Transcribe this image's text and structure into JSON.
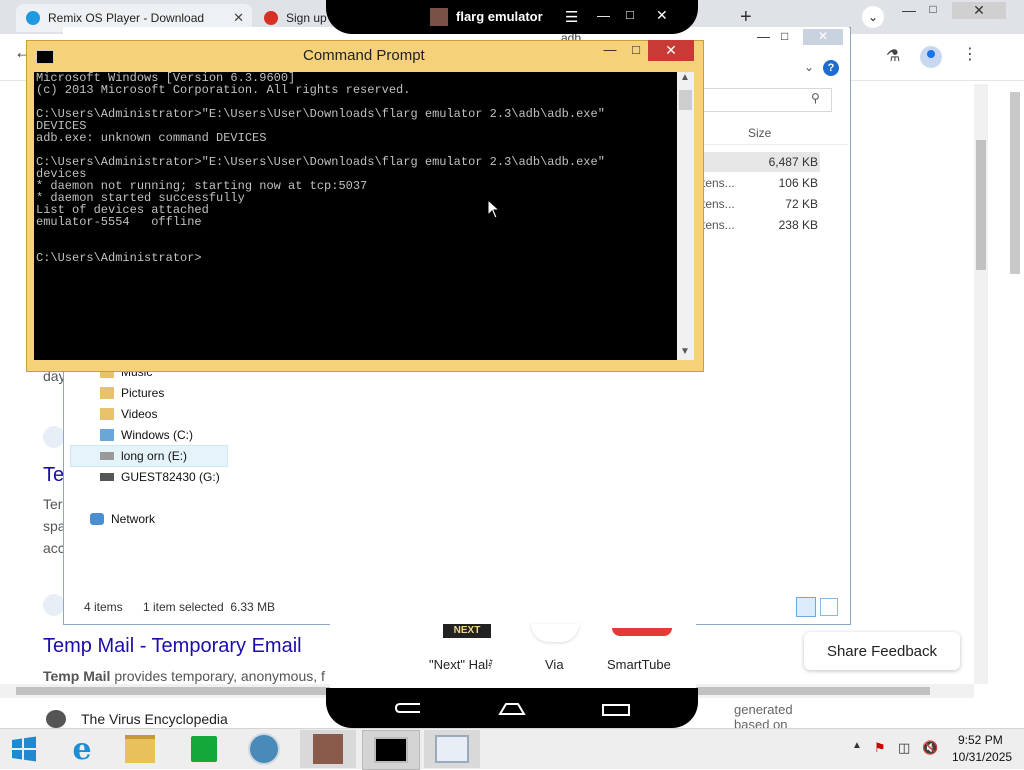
{
  "browser": {
    "tabs": [
      {
        "title": "Remix OS Player - Download",
        "favicon": "remix-icon",
        "close": "✕"
      },
      {
        "title": "Sign up",
        "favicon": "mail-icon"
      }
    ],
    "new_tab": "+",
    "results": [
      {
        "snippet": "day"
      },
      {
        "title": "Te",
        "snippet_lines": [
          "Ter",
          "spa",
          "acc"
        ]
      },
      {
        "title": "Temp Mail - Temporary Email",
        "snippet_bold": "Temp Mail",
        "snippet": "provides temporary, anonymous, f"
      },
      {
        "title": "The Virus Encyclopedia"
      }
    ],
    "right_fragment": [
      "generated",
      "based on"
    ],
    "share_feedback": "Share Feedback"
  },
  "explorer": {
    "address_fragment": "adb",
    "column_size": "Size",
    "files": [
      {
        "type": "",
        "size": "6,487 KB"
      },
      {
        "type": "tens...",
        "size": "106 KB"
      },
      {
        "type": "tens...",
        "size": "72 KB"
      },
      {
        "type": "tens...",
        "size": "238 KB"
      }
    ],
    "nav": [
      "Music",
      "Pictures",
      "Videos",
      "Windows (C:)",
      "long orn (E:)",
      "GUEST82430 (G:)",
      "Network"
    ],
    "status": {
      "items": "4 items",
      "selected": "1 item selected  6.33 MB"
    }
  },
  "emulator": {
    "title": "flarg emulator",
    "apps": [
      "\"Next\" Hal𝅀",
      "Via",
      "SmartTube"
    ],
    "next_badge": "NEXT"
  },
  "cmd": {
    "title": "Command Prompt",
    "lines": "Microsoft Windows [Version 6.3.9600]\n(c) 2013 Microsoft Corporation. All rights reserved.\n\nC:\\Users\\Administrator>\"E:\\Users\\User\\Downloads\\flarg emulator 2.3\\adb\\adb.exe\"\nDEVICES\nadb.exe: unknown command DEVICES\n\nC:\\Users\\Administrator>\"E:\\Users\\User\\Downloads\\flarg emulator 2.3\\adb\\adb.exe\"\ndevices\n* daemon not running; starting now at tcp:5037\n* daemon started successfully\nList of devices attached\nemulator-5554   offline\n\n\nC:\\Users\\Administrator>"
  },
  "taskbar": {
    "time": "9:52 PM",
    "date": "10/31/2025"
  },
  "colors": {
    "cmd_border": "#f5d17a",
    "close_red": "#c73a36",
    "link_blue": "#1a0dab"
  }
}
